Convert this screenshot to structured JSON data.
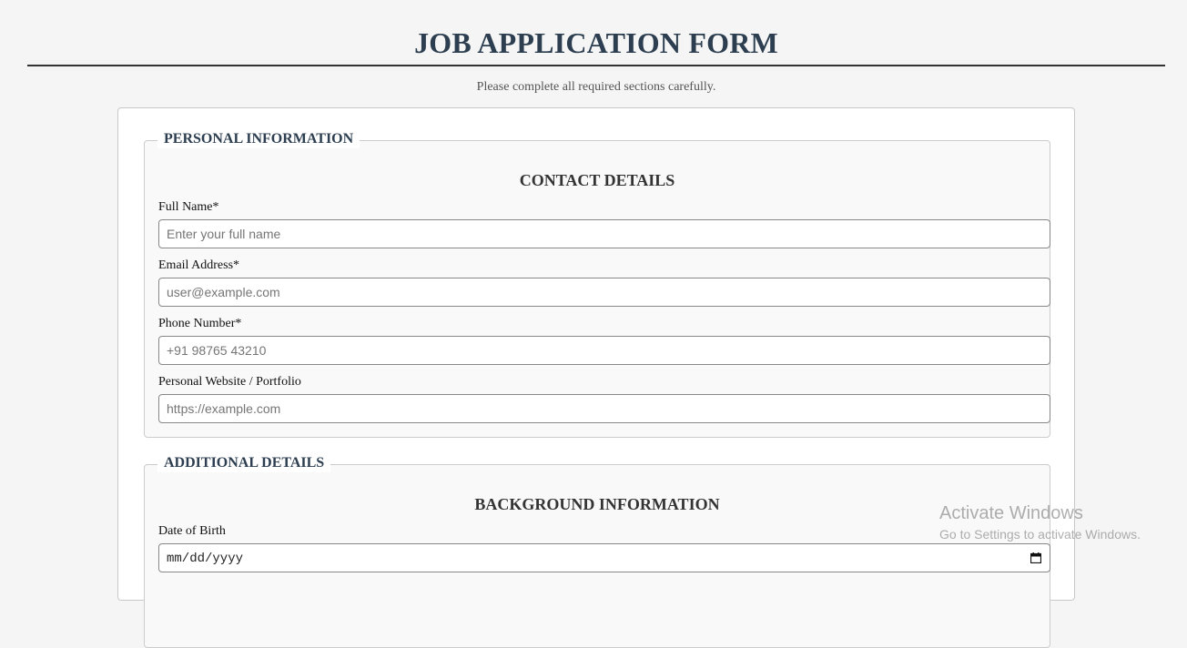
{
  "header": {
    "title": "JOB APPLICATION FORM",
    "subtitle": "Please complete all required sections carefully."
  },
  "personal_information": {
    "legend": "PERSONAL INFORMATION",
    "heading": "CONTACT DETAILS",
    "fields": [
      {
        "label": "Full Name*",
        "placeholder": "Enter your full name",
        "value": ""
      },
      {
        "label": "Email Address*",
        "placeholder": "user@example.com",
        "value": ""
      },
      {
        "label": "Phone Number*",
        "placeholder": "+91 98765 43210",
        "value": ""
      },
      {
        "label": "Personal Website / Portfolio",
        "placeholder": "https://example.com",
        "value": ""
      }
    ]
  },
  "additional_details": {
    "legend": "ADDITIONAL DETAILS",
    "heading": "BACKGROUND INFORMATION",
    "dob_label": "Date of Birth",
    "dob_placeholder": "mm/dd/yyyy",
    "dob_icon": "calendar-icon"
  },
  "watermark": {
    "title": "Activate Windows",
    "subtitle": "Go to Settings to activate Windows."
  },
  "colors": {
    "page_background": "#f5f5f5",
    "title": "#2c3e50",
    "fieldset_background": "#f9f9f9",
    "card_background": "#ffffff"
  }
}
